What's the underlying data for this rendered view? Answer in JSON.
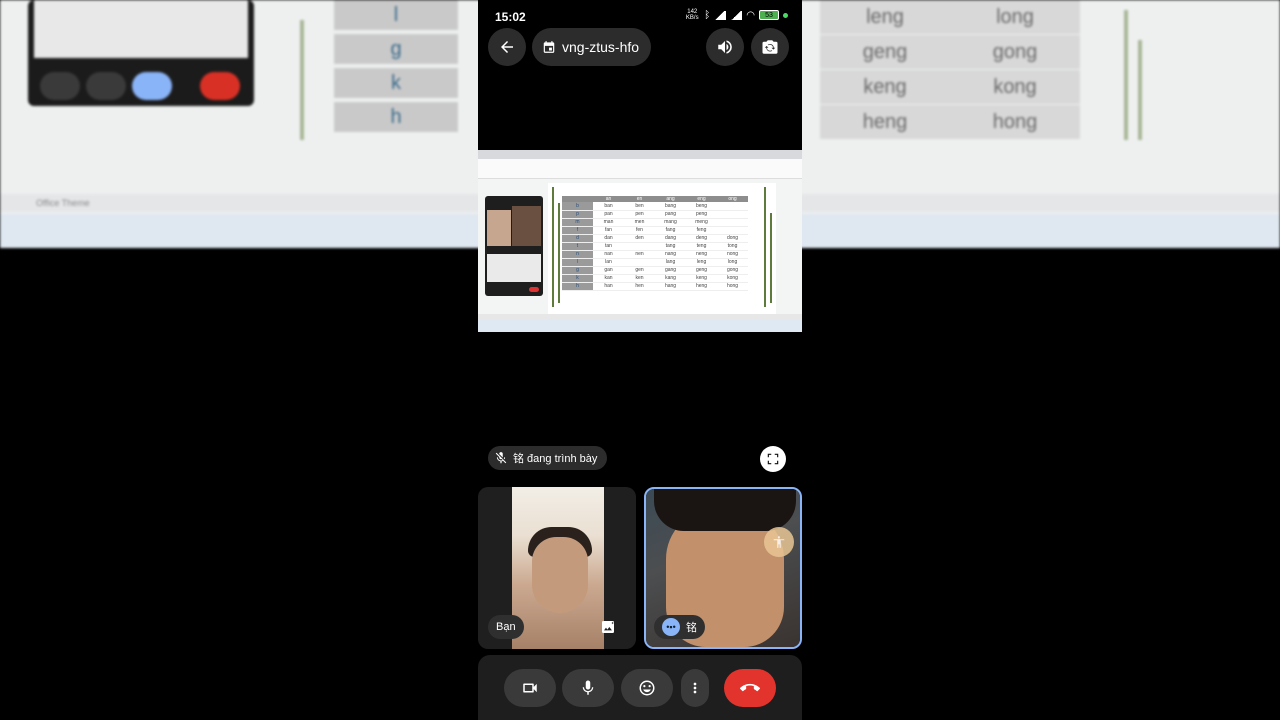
{
  "status_bar": {
    "time": "15:02",
    "net_speed": "142 KB/s",
    "battery": "53"
  },
  "header": {
    "meeting_code": "vng-ztus-hfo"
  },
  "shared_screen": {
    "table_headers": [
      "",
      "an",
      "en",
      "ang",
      "eng",
      "ong"
    ],
    "rows": [
      [
        "b",
        "ban",
        "ben",
        "bang",
        "beng",
        ""
      ],
      [
        "p",
        "pan",
        "pen",
        "pang",
        "peng",
        ""
      ],
      [
        "m",
        "man",
        "men",
        "mang",
        "meng",
        ""
      ],
      [
        "f",
        "fan",
        "fen",
        "fang",
        "feng",
        ""
      ],
      [
        "d",
        "dan",
        "den",
        "dang",
        "deng",
        "dong"
      ],
      [
        "t",
        "tan",
        "",
        "tang",
        "teng",
        "tong"
      ],
      [
        "n",
        "nan",
        "nen",
        "nang",
        "neng",
        "nong"
      ],
      [
        "l",
        "lan",
        "",
        "lang",
        "leng",
        "long"
      ],
      [
        "g",
        "gan",
        "gen",
        "gang",
        "geng",
        "gong"
      ],
      [
        "k",
        "kan",
        "ken",
        "kang",
        "keng",
        "kong"
      ],
      [
        "h",
        "han",
        "hen",
        "hang",
        "heng",
        "hong"
      ]
    ]
  },
  "presenter": {
    "label": "铭 đang trình bày"
  },
  "participants": {
    "self_label": "Bạn",
    "remote_label": "铭"
  },
  "background": {
    "left_column": [
      "l",
      "g",
      "k",
      "h"
    ],
    "right_rows": [
      [
        "leng",
        "long"
      ],
      [
        "geng",
        "gong"
      ],
      [
        "keng",
        "kong"
      ],
      [
        "heng",
        "hong"
      ]
    ],
    "office_status": "Office Theme"
  },
  "colors": {
    "end_call": "#e2342c",
    "active_border": "#8ab4f8",
    "chip_bg": "#2c2c2c"
  }
}
